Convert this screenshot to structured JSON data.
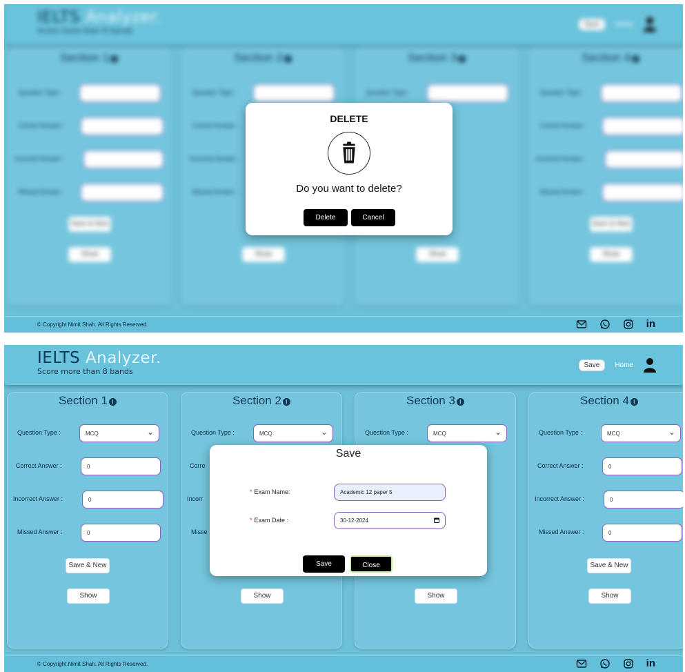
{
  "app": {
    "brand_main": "IELTS",
    "brand_accent": "Analyzer.",
    "tagline": "Score more than 8 bands",
    "nav_save": "Save",
    "nav_home": "Home"
  },
  "sections": [
    {
      "title": "Section 1",
      "question_type_label": "Question Type :",
      "question_type_value": "MCQ",
      "correct_label": "Correct Answer :",
      "correct_value": "0",
      "incorrect_label": "Incorrect Answer :",
      "incorrect_value": "0",
      "missed_label": "Missed Answer :",
      "missed_value": "0",
      "save_new_label": "Save & New",
      "show_label": "Show"
    },
    {
      "title": "Section 2",
      "question_type_label": "Question Type :",
      "question_type_value": "MCQ",
      "correct_label": "Corre",
      "incorrect_label": "Incorr",
      "missed_label": "Misse",
      "show_label": "Show"
    },
    {
      "title": "Section 3",
      "question_type_label": "Question Type :",
      "question_type_value": "MCQ",
      "show_label": "Show"
    },
    {
      "title": "Section 4",
      "question_type_label": "Question Type :",
      "question_type_value": "MCQ",
      "correct_label": "Correct Answer :",
      "correct_value": "0",
      "incorrect_label": "Incorrect Answer :",
      "incorrect_value": "0",
      "missed_label": "Missed Answer :",
      "missed_value": "0",
      "save_new_label": "Save & New",
      "show_label": "Show"
    }
  ],
  "footer": {
    "copyright": "© Copyright Nimit Shah. All Rights Reserved.",
    "linkedin": "in"
  },
  "delete_modal": {
    "title": "DELETE",
    "question": "Do you want to delete?",
    "delete_label": "Delete",
    "cancel_label": "Cancel"
  },
  "save_modal": {
    "title": "Save",
    "exam_name_label": "Exam Name:",
    "exam_name_value": "Academic 12 paper 5",
    "exam_date_label": "Exam Date :",
    "exam_date_value": "30-12-2024",
    "required_mark": "*",
    "save_label": "Save",
    "close_label": "Close"
  },
  "colors": {
    "background": "#6cc0d8",
    "panel": "#74c5dd",
    "field_border": "#8a5fc0",
    "dark_button": "#000000",
    "close_outline": "#c9ec9e"
  }
}
